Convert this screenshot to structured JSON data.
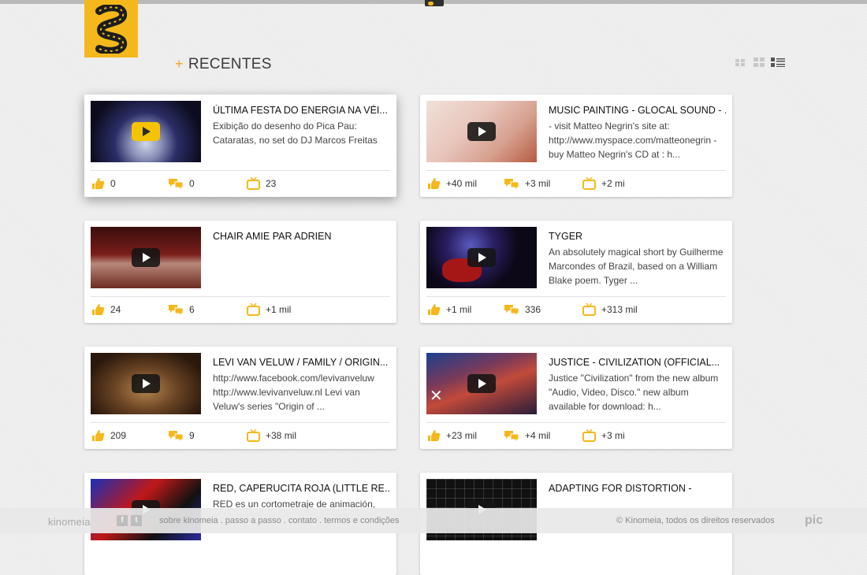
{
  "header": {
    "section_title": "RECENTES",
    "plus": "+"
  },
  "colors": {
    "accent": "#f5b81c",
    "plus": "#f2a31e",
    "stat_icon": "#f5b81c"
  },
  "icons": {
    "likes": "thumbs-up-icon",
    "comments": "speech-bubbles-icon",
    "views": "tv-icon"
  },
  "view_switcher": [
    {
      "name": "view-small-grid-icon"
    },
    {
      "name": "view-large-grid-icon"
    },
    {
      "name": "view-list-icon",
      "selected": true
    }
  ],
  "videos": [
    {
      "title": "ÚLTIMA FESTA DO ENERGIA NA VÉI...",
      "desc": "Exibição do desenho do Pica Pau: Cataratas, no set do DJ Marcos Freitas",
      "likes": "0",
      "comments": "0",
      "views": "23"
    },
    {
      "title": "MUSIC PAINTING - GLOCAL SOUND - ...",
      "desc": "- visit Matteo Negrin's site at: http://www.myspace.com/matteonegrin - buy Matteo Negrin's CD at : h...",
      "likes": "+40 mil",
      "comments": "+3 mil",
      "views": "+2 mi"
    },
    {
      "title": "CHAIR AMIE PAR ADRIEN",
      "desc": "",
      "likes": "24",
      "comments": "6",
      "views": "+1 mil"
    },
    {
      "title": "TYGER",
      "desc": "An absolutely magical short by Guilherme Marcondes of Brazil, based on a William Blake poem. Tyger ...",
      "likes": "+1 mil",
      "comments": "336",
      "views": "+313 mil"
    },
    {
      "title": "LEVI VAN VELUW / FAMILY / ORIGIN...",
      "desc": "http://www.facebook.com/levivanveluw http://www.levivanveluw.nl Levi van Veluw's series \"Origin of ...",
      "likes": "209",
      "comments": "9",
      "views": "+38 mil"
    },
    {
      "title": "JUSTICE - CIVILIZATION (OFFICIAL...",
      "desc": "Justice \"Civilization\" from the new album \"Audio, Video, Disco.\" new album available for download: h...",
      "likes": "+23 mil",
      "comments": "+4 mil",
      "views": "+3 mi"
    },
    {
      "title": "RED, CAPERUCITA ROJA (LITTLE RE...",
      "desc": "RED es un cortometraje de animación,",
      "likes": "",
      "comments": "",
      "views": ""
    },
    {
      "title": "ADAPTING FOR DISTORTION -",
      "desc": "",
      "likes": "",
      "comments": "",
      "views": ""
    }
  ],
  "footer": {
    "brand": "kinomeia",
    "social": [
      "f",
      "t"
    ],
    "links": [
      "sobre kinomeia",
      "passo a passo",
      "contato",
      "termos e condições"
    ],
    "separator": " . ",
    "copyright": "© Kinomeia, todos os direitos reservados",
    "partner": "pic"
  }
}
